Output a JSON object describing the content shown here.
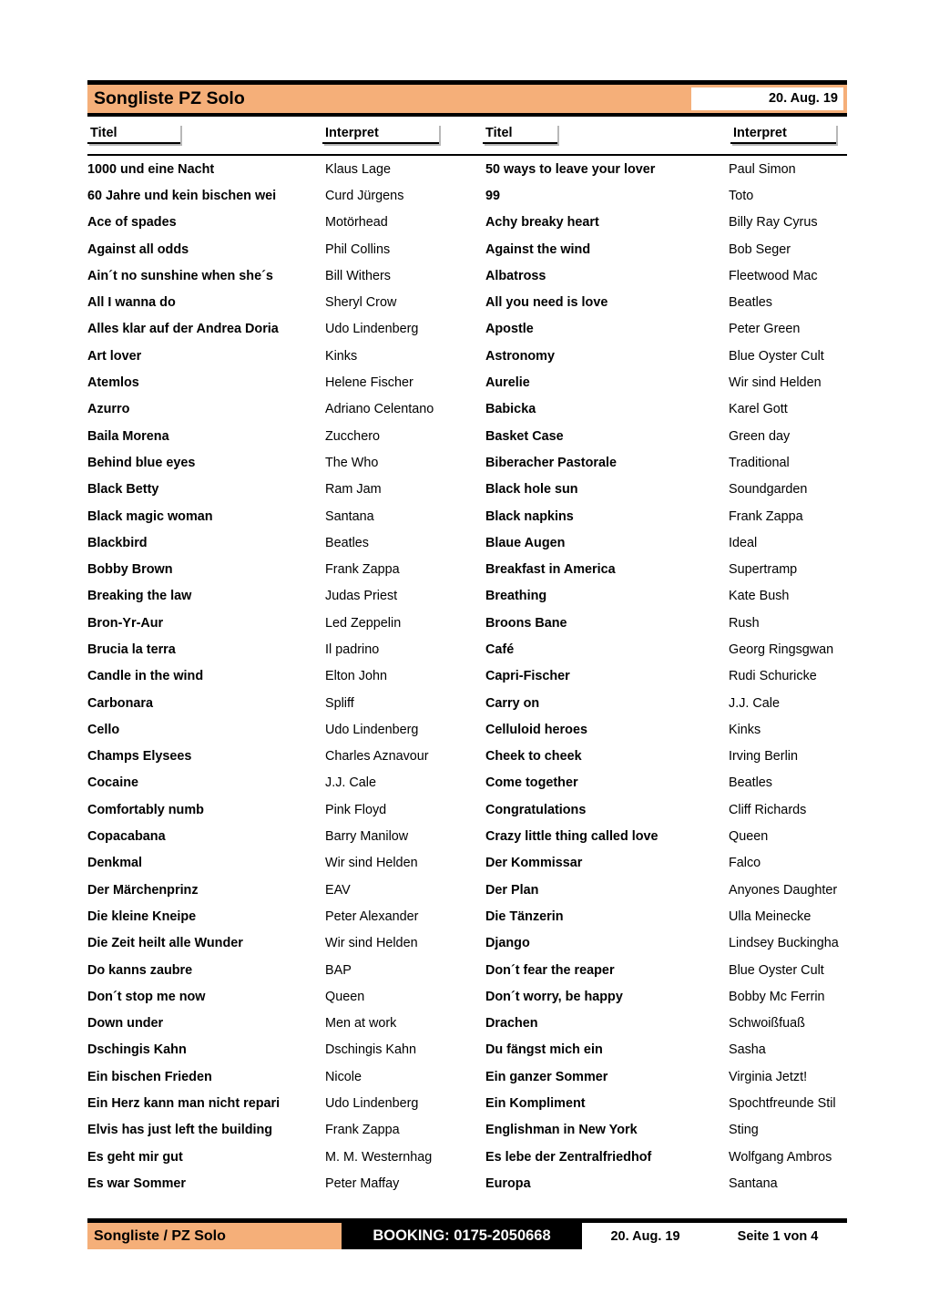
{
  "header": {
    "title": "Songliste PZ Solo",
    "date": "20. Aug. 19",
    "accent_color": "#F5AF79"
  },
  "columns": {
    "c1": "Titel",
    "c2": "Interpret",
    "c3": "Titel",
    "c4": "Interpret"
  },
  "rows": [
    {
      "title_left": "1000 und eine Nacht",
      "artist_left": "Klaus Lage",
      "title_right": "50 ways to leave your lover",
      "artist_right": "Paul Simon"
    },
    {
      "title_left": "60 Jahre und kein bischen wei",
      "artist_left": "Curd Jürgens",
      "title_right": "99",
      "artist_right": "Toto"
    },
    {
      "title_left": "Ace of spades",
      "artist_left": "Motörhead",
      "title_right": "Achy breaky heart",
      "artist_right": "Billy Ray Cyrus"
    },
    {
      "title_left": "Against all odds",
      "artist_left": "Phil Collins",
      "title_right": "Against the wind",
      "artist_right": "Bob Seger"
    },
    {
      "title_left": "Ain´t no sunshine when she´s",
      "artist_left": "Bill Withers",
      "title_right": "Albatross",
      "artist_right": "Fleetwood Mac"
    },
    {
      "title_left": "All I wanna do",
      "artist_left": "Sheryl Crow",
      "title_right": "All you need is love",
      "artist_right": "Beatles"
    },
    {
      "title_left": "Alles klar auf der Andrea Doria",
      "artist_left": "Udo Lindenberg",
      "title_right": "Apostle",
      "artist_right": "Peter Green"
    },
    {
      "title_left": "Art lover",
      "artist_left": "Kinks",
      "title_right": "Astronomy",
      "artist_right": "Blue Oyster Cult"
    },
    {
      "title_left": "Atemlos",
      "artist_left": "Helene Fischer",
      "title_right": "Aurelie",
      "artist_right": "Wir sind Helden"
    },
    {
      "title_left": "Azurro",
      "artist_left": "Adriano Celentano",
      "title_right": "Babicka",
      "artist_right": "Karel Gott"
    },
    {
      "title_left": "Baila Morena",
      "artist_left": "Zucchero",
      "title_right": "Basket Case",
      "artist_right": "Green day"
    },
    {
      "title_left": "Behind blue eyes",
      "artist_left": "The Who",
      "title_right": "Biberacher Pastorale",
      "artist_right": "Traditional"
    },
    {
      "title_left": "Black Betty",
      "artist_left": "Ram Jam",
      "title_right": "Black hole sun",
      "artist_right": "Soundgarden"
    },
    {
      "title_left": "Black magic woman",
      "artist_left": "Santana",
      "title_right": "Black napkins",
      "artist_right": "Frank Zappa"
    },
    {
      "title_left": "Blackbird",
      "artist_left": "Beatles",
      "title_right": "Blaue Augen",
      "artist_right": "Ideal"
    },
    {
      "title_left": "Bobby Brown",
      "artist_left": "Frank Zappa",
      "title_right": "Breakfast in America",
      "artist_right": "Supertramp"
    },
    {
      "title_left": "Breaking the law",
      "artist_left": "Judas Priest",
      "title_right": "Breathing",
      "artist_right": "Kate Bush"
    },
    {
      "title_left": "Bron-Yr-Aur",
      "artist_left": "Led Zeppelin",
      "title_right": "Broons Bane",
      "artist_right": "Rush"
    },
    {
      "title_left": "Brucia la terra",
      "artist_left": "Il padrino",
      "title_right": "Café",
      "artist_right": "Georg Ringsgwan"
    },
    {
      "title_left": "Candle in the wind",
      "artist_left": "Elton John",
      "title_right": "Capri-Fischer",
      "artist_right": "Rudi Schuricke"
    },
    {
      "title_left": "Carbonara",
      "artist_left": "Spliff",
      "title_right": "Carry on",
      "artist_right": "J.J. Cale"
    },
    {
      "title_left": "Cello",
      "artist_left": "Udo Lindenberg",
      "title_right": "Celluloid heroes",
      "artist_right": "Kinks"
    },
    {
      "title_left": "Champs Elysees",
      "artist_left": "Charles Aznavour",
      "title_right": "Cheek to cheek",
      "artist_right": "Irving Berlin"
    },
    {
      "title_left": "Cocaine",
      "artist_left": "J.J. Cale",
      "title_right": "Come together",
      "artist_right": "Beatles"
    },
    {
      "title_left": "Comfortably numb",
      "artist_left": "Pink Floyd",
      "title_right": "Congratulations",
      "artist_right": "Cliff Richards"
    },
    {
      "title_left": "Copacabana",
      "artist_left": "Barry Manilow",
      "title_right": "Crazy little thing called love",
      "artist_right": "Queen"
    },
    {
      "title_left": "Denkmal",
      "artist_left": "Wir sind Helden",
      "title_right": "Der Kommissar",
      "artist_right": "Falco"
    },
    {
      "title_left": "Der Märchenprinz",
      "artist_left": "EAV",
      "title_right": "Der Plan",
      "artist_right": "Anyones Daughter"
    },
    {
      "title_left": "Die kleine Kneipe",
      "artist_left": "Peter Alexander",
      "title_right": "Die Tänzerin",
      "artist_right": "Ulla Meinecke"
    },
    {
      "title_left": "Die Zeit heilt alle Wunder",
      "artist_left": "Wir sind Helden",
      "title_right": "Django",
      "artist_right": "Lindsey Buckingha"
    },
    {
      "title_left": "Do kanns zaubre",
      "artist_left": "BAP",
      "title_right": "Don´t fear the reaper",
      "artist_right": "Blue Oyster Cult"
    },
    {
      "title_left": "Don´t stop me now",
      "artist_left": "Queen",
      "title_right": "Don´t worry, be happy",
      "artist_right": "Bobby Mc Ferrin"
    },
    {
      "title_left": "Down under",
      "artist_left": "Men at work",
      "title_right": "Drachen",
      "artist_right": "Schwoißfuaß"
    },
    {
      "title_left": "Dschingis Kahn",
      "artist_left": "Dschingis Kahn",
      "title_right": "Du fängst mich ein",
      "artist_right": "Sasha"
    },
    {
      "title_left": "Ein bischen Frieden",
      "artist_left": "Nicole",
      "title_right": "Ein ganzer Sommer",
      "artist_right": "Virginia Jetzt!"
    },
    {
      "title_left": "Ein Herz kann man nicht repari",
      "artist_left": "Udo Lindenberg",
      "title_right": "Ein Kompliment",
      "artist_right": "Spochtfreunde Stil"
    },
    {
      "title_left": "Elvis has just left the building",
      "artist_left": "Frank Zappa",
      "title_right": "Englishman in New York",
      "artist_right": "Sting"
    },
    {
      "title_left": "Es geht mir gut",
      "artist_left": "M. M. Westernhag",
      "title_right": "Es lebe der Zentralfriedhof",
      "artist_right": "Wolfgang Ambros"
    },
    {
      "title_left": "Es war Sommer",
      "artist_left": "Peter Maffay",
      "title_right": "Europa",
      "artist_right": "Santana"
    }
  ],
  "footer": {
    "left_label": "Songliste / PZ Solo",
    "booking": "BOOKING: 0175-2050668",
    "date": "20. Aug. 19",
    "page": "Seite 1 von 4"
  }
}
